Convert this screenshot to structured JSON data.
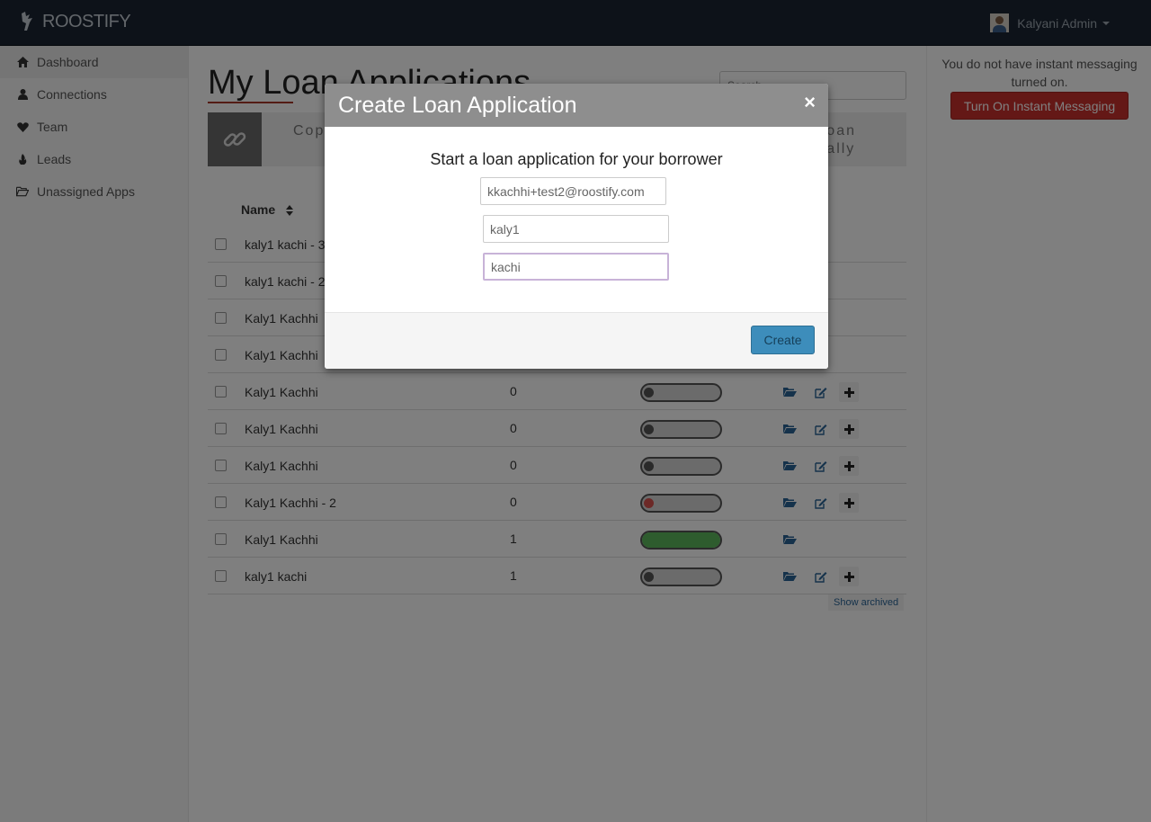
{
  "navbar": {
    "brand": "ROOSTIFY",
    "user_name": "Kalyani Admin"
  },
  "sidebar": {
    "items": [
      {
        "label": "Dashboard",
        "icon": "home-icon",
        "active": true
      },
      {
        "label": "Connections",
        "icon": "user-icon"
      },
      {
        "label": "Team",
        "icon": "heart-icon"
      },
      {
        "label": "Leads",
        "icon": "fire-icon"
      },
      {
        "label": "Unassigned Apps",
        "icon": "folder-open-icon"
      }
    ]
  },
  "main": {
    "title": "My Loan Applications",
    "search_placeholder": "Search",
    "banner": {
      "copy_text": "Cop",
      "right_text_line1": "oan",
      "right_text_line2": "ally"
    },
    "table": {
      "name_header": "Name",
      "rows": [
        {
          "name": "kaly1 kachi - 3",
          "count": "",
          "progress": 0,
          "state": "hidden"
        },
        {
          "name": "kaly1 kachi - 2",
          "count": "",
          "progress": 0,
          "state": "hidden"
        },
        {
          "name": "Kaly1 Kachhi",
          "count": "",
          "progress": 0,
          "state": "hidden"
        },
        {
          "name": "Kaly1 Kachhi",
          "count": "",
          "progress": 0,
          "state": "hidden"
        },
        {
          "name": "Kaly1 Kachhi",
          "count": "0",
          "progress": 0,
          "state": "grey"
        },
        {
          "name": "Kaly1 Kachhi",
          "count": "0",
          "progress": 0,
          "state": "grey"
        },
        {
          "name": "Kaly1 Kachhi",
          "count": "0",
          "progress": 0,
          "state": "grey"
        },
        {
          "name": "Kaly1 Kachhi - 2",
          "count": "0",
          "progress": 0,
          "state": "red"
        },
        {
          "name": "Kaly1 Kachhi",
          "count": "1",
          "progress": 1.0,
          "state": "green"
        },
        {
          "name": "kaly1 kachi",
          "count": "1",
          "progress": 0,
          "state": "grey"
        }
      ],
      "show_archived": "Show archived"
    }
  },
  "right_panel": {
    "im_text": "You do not have instant messaging turned on.",
    "im_button": "Turn On Instant Messaging"
  },
  "modal": {
    "title": "Create Loan Application",
    "close": "×",
    "prompt": "Start a loan application for your borrower",
    "email_value": "kkachhi+test2@roostify.com",
    "first_name_value": "kaly1",
    "last_name_value": "kachi",
    "create_label": "Create"
  },
  "colors": {
    "navbar": "#1a2533",
    "modal_header": "#8e8e8e",
    "create_button": "#3d8dbb",
    "im_button": "#c9302c",
    "progress_green": "#5cb85c",
    "progress_red": "#d9534f"
  }
}
